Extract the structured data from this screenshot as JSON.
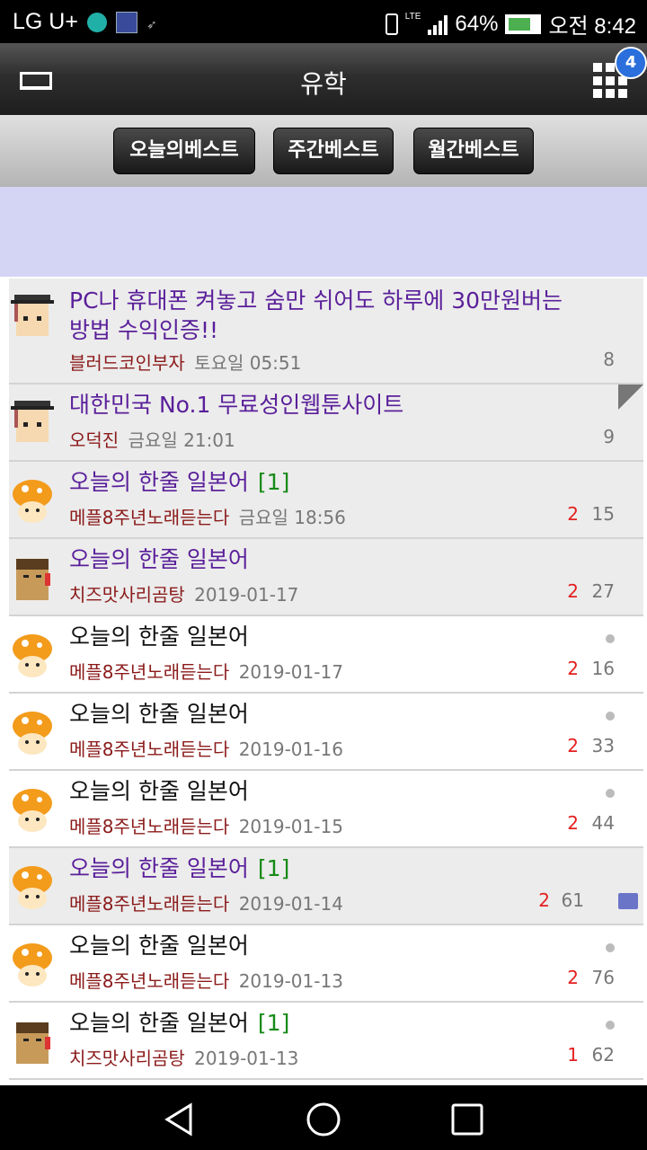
{
  "status_bar": {
    "carrier": "LG U+",
    "network": "LTE",
    "battery": "64%",
    "time": "오전 8:42"
  },
  "app_bar": {
    "title": "유학",
    "notification_count": "4"
  },
  "tabs": [
    {
      "label": "오늘의베스트"
    },
    {
      "label": "주간베스트"
    },
    {
      "label": "월간베스트"
    }
  ],
  "posts": [
    {
      "title": "PC나 휴대폰 켜놓고 숨만 쉬어도 하루에 30만원버는",
      "title2": "방법 수익인증!!",
      "comments": "",
      "author": "블러드코인부자",
      "date": "토요일 05:51",
      "recommend": "",
      "views": "8",
      "avatar": "graduate",
      "visited": true
    },
    {
      "title": "대한민국 No.1 무료성인웹툰사이트",
      "comments": "",
      "author": "오덕진",
      "date": "금요일 21:01",
      "recommend": "",
      "views": "9",
      "avatar": "graduate",
      "visited": true
    },
    {
      "title": "오늘의 한줄 일본어",
      "comments": "[1]",
      "author": "메플8주년노래듣는다",
      "date": "금요일 18:56",
      "recommend": "2",
      "views": "15",
      "avatar": "mushroom",
      "visited": true
    },
    {
      "title": "오늘의 한줄 일본어",
      "comments": "",
      "author": "치즈맛사리곰탕",
      "date": "2019-01-17",
      "recommend": "2",
      "views": "27",
      "avatar": "warrior",
      "visited": true
    },
    {
      "title": "오늘의 한줄 일본어",
      "comments": "",
      "author": "메플8주년노래듣는다",
      "date": "2019-01-17",
      "recommend": "2",
      "views": "16",
      "avatar": "mushroom",
      "visited": false
    },
    {
      "title": "오늘의 한줄 일본어",
      "comments": "",
      "author": "메플8주년노래듣는다",
      "date": "2019-01-16",
      "recommend": "2",
      "views": "33",
      "avatar": "mushroom",
      "visited": false
    },
    {
      "title": "오늘의 한줄 일본어",
      "comments": "",
      "author": "메플8주년노래듣는다",
      "date": "2019-01-15",
      "recommend": "2",
      "views": "44",
      "avatar": "mushroom",
      "visited": false
    },
    {
      "title": "오늘의 한줄 일본어",
      "comments": "[1]",
      "author": "메플8주년노래듣는다",
      "date": "2019-01-14",
      "recommend": "2",
      "views": "61",
      "avatar": "mushroom",
      "visited": true
    },
    {
      "title": "오늘의 한줄 일본어",
      "comments": "",
      "author": "메플8주년노래듣는다",
      "date": "2019-01-13",
      "recommend": "2",
      "views": "76",
      "avatar": "mushroom",
      "visited": false
    },
    {
      "title": "오늘의 한줄 일본어",
      "comments": "[1]",
      "author": "치즈맛사리곰탕",
      "date": "2019-01-13",
      "recommend": "1",
      "views": "62",
      "avatar": "warrior",
      "visited": false
    }
  ]
}
